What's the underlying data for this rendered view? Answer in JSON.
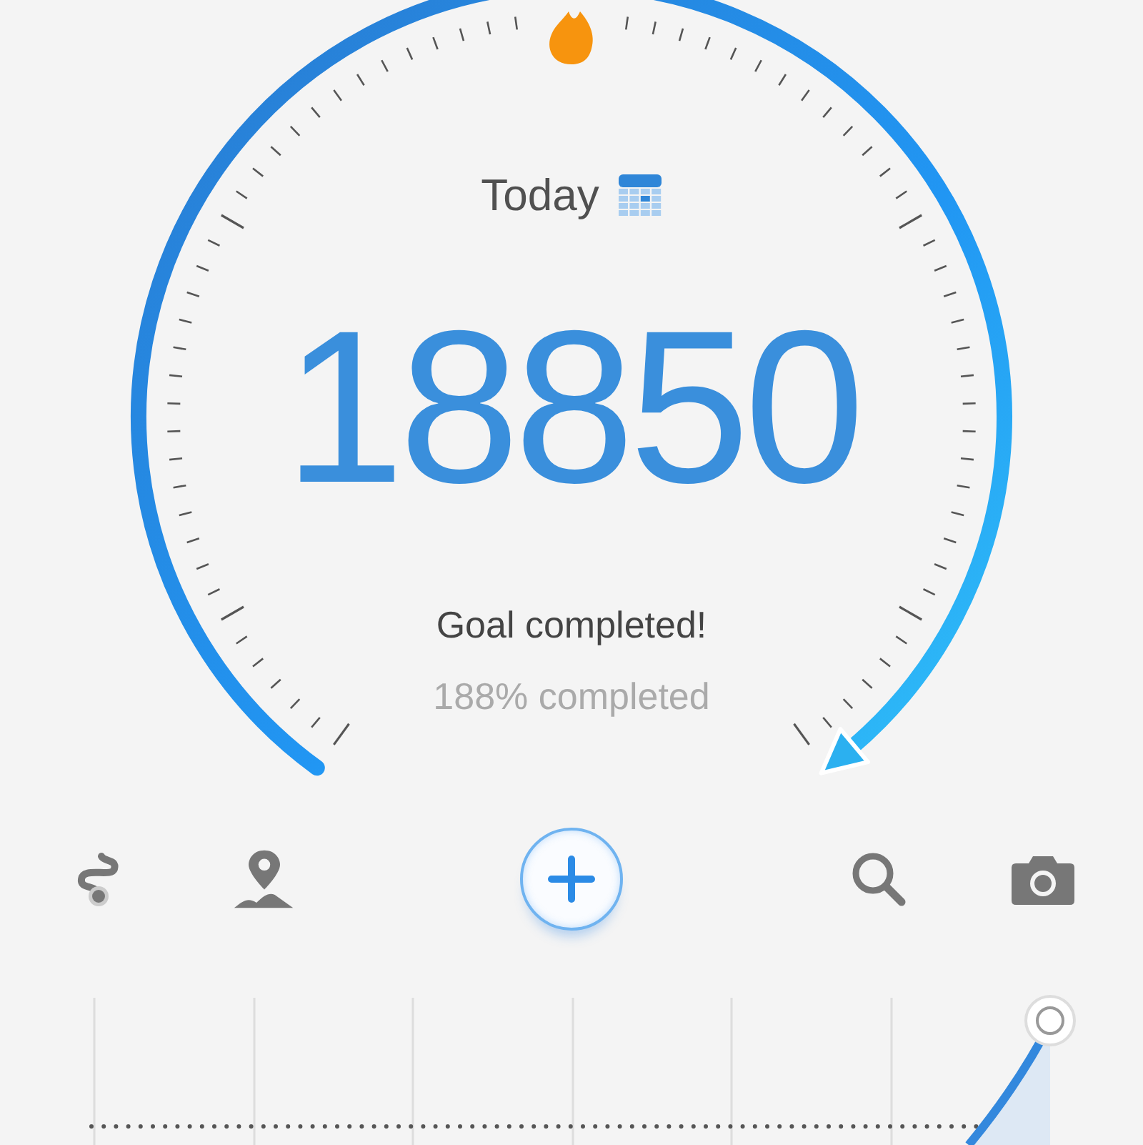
{
  "gauge": {
    "title": "Today",
    "steps": "18850",
    "status": "Goal completed!",
    "progress": "188% completed"
  }
}
